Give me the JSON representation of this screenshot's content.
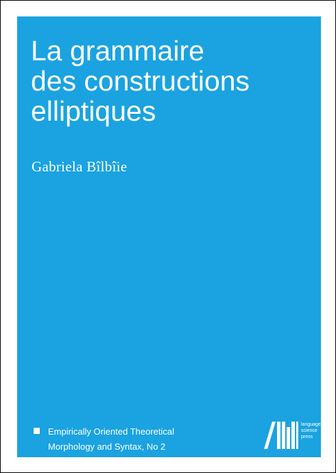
{
  "book": {
    "title_lines": [
      "La grammaire",
      "des constructions",
      "elliptiques"
    ],
    "author": "Gabriela Bîlbîie",
    "series_lines": [
      "Empirically Oriented Theoretical",
      "Morphology and Syntax, No 2"
    ]
  },
  "publisher": {
    "logo_icon": "language-science-press-logo",
    "name_lines": [
      "language",
      "science",
      "press"
    ]
  },
  "colors": {
    "cover_background": "#1aa3e0",
    "text": "#ffffff",
    "frame": "#000000"
  }
}
